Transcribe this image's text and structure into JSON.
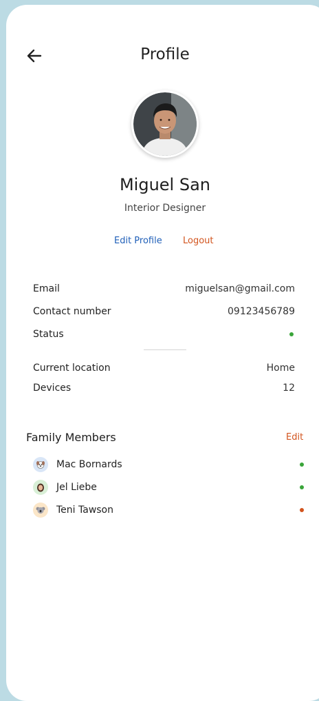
{
  "header": {
    "title": "Profile",
    "back_icon": "arrow-left-icon"
  },
  "profile": {
    "name": "Miguel San",
    "role": "Interior Designer",
    "edit_label": "Edit Profile",
    "logout_label": "Logout"
  },
  "details": [
    {
      "label": "Email",
      "value": "miguelsan@gmail.com"
    },
    {
      "label": "Contact number",
      "value": "09123456789"
    },
    {
      "label": "Status",
      "value": "",
      "status_color": "#3aa53a"
    }
  ],
  "details2": [
    {
      "label": "Current location",
      "value": "Home"
    },
    {
      "label": "Devices",
      "value": "12"
    }
  ],
  "family": {
    "title": "Family Members",
    "edit_label": "Edit",
    "members": [
      {
        "name": "Mac Bornards",
        "status_color": "#3aa53a",
        "avatar_bg": "#d9e6f7"
      },
      {
        "name": "Jel Liebe",
        "status_color": "#3aa53a",
        "avatar_bg": "#d8efd6"
      },
      {
        "name": "Teni Tawson",
        "status_color": "#d2541e",
        "avatar_bg": "#fbe6c8"
      }
    ]
  },
  "colors": {
    "background": "#bcdbe4",
    "link_blue": "#1f5fb8",
    "accent_orange": "#d2541e",
    "online_green": "#3aa53a"
  }
}
